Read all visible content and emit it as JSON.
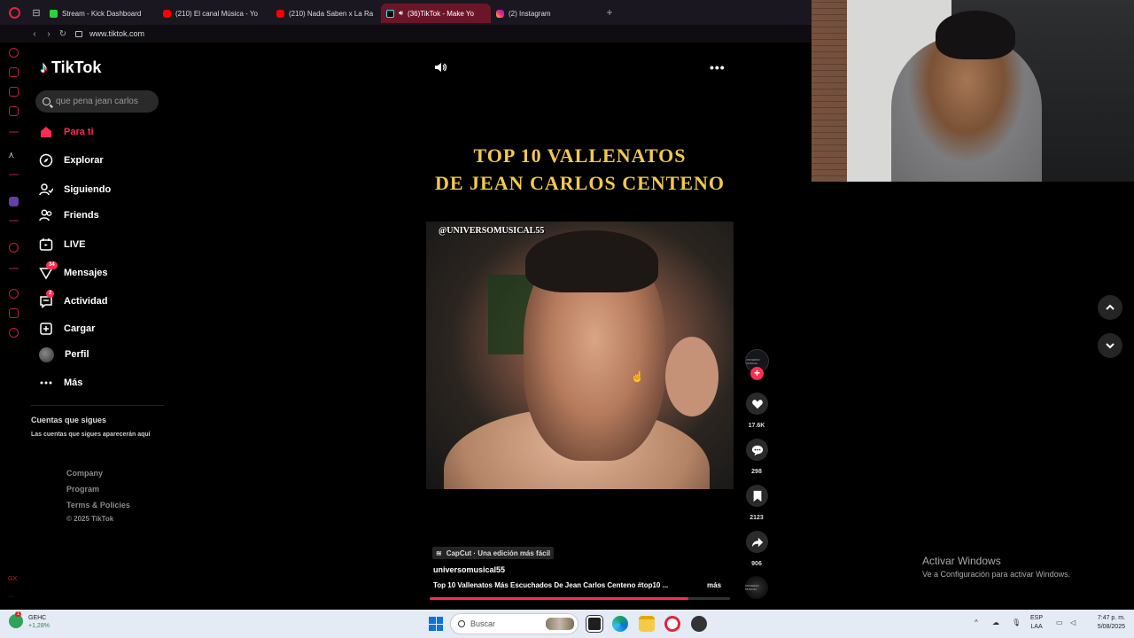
{
  "browser": {
    "tabs": [
      {
        "label": "Stream - Kick Dashboard",
        "favicon": "kick-icon",
        "active": false
      },
      {
        "label": "(210) El canal Música - Yo",
        "favicon": "youtube-icon",
        "active": false
      },
      {
        "label": "(210) Nada Saben x La Ra",
        "favicon": "youtube-icon",
        "active": false
      },
      {
        "label": "(36)TikTok - Make Yo",
        "favicon": "tiktok-icon",
        "active": true
      },
      {
        "label": "(2) Instagram",
        "favicon": "instagram-icon",
        "active": false
      }
    ],
    "new_tab_label": "+",
    "url": "www.tiktok.com",
    "accent": "#e0253a"
  },
  "tiktok": {
    "logo_text": "TikTok",
    "search_placeholder": "que pena jean carlos",
    "nav": [
      {
        "label": "Para ti",
        "icon": "home-icon",
        "active": true
      },
      {
        "label": "Explorar",
        "icon": "compass-icon"
      },
      {
        "label": "Siguiendo",
        "icon": "following-icon"
      },
      {
        "label": "Friends",
        "icon": "friends-icon"
      },
      {
        "label": "LIVE",
        "icon": "live-icon"
      },
      {
        "label": "Mensajes",
        "icon": "messages-icon",
        "badge": "34"
      },
      {
        "label": "Actividad",
        "icon": "activity-icon",
        "badge": "2"
      },
      {
        "label": "Cargar",
        "icon": "upload-icon"
      },
      {
        "label": "Perfil",
        "icon": "profile-avatar"
      },
      {
        "label": "Más",
        "icon": "more-icon"
      }
    ],
    "following_title": "Cuentas que sigues",
    "following_sub": "Las cuentas que sigues aparecerán aquí",
    "footer_links": [
      "Company",
      "Program",
      "Terms & Policies"
    ],
    "copyright": "© 2025 TikTok",
    "brand_color": "#fe2c55"
  },
  "video": {
    "title_line1": "TOP 10 VALLENATOS",
    "title_line2": "DE JEAN CARLOS CENTENO",
    "watermark": "@UNIVERSOMUSICAL55",
    "capcut_label": "CapCut · Una edición más fácil",
    "author": "universomusical55",
    "description": "Top 10 Vallenatos Más Escuchados De Jean Carlos Centeno #top10 ...",
    "more_label": "más",
    "progress": 0.86,
    "title_color": "#f2c94c"
  },
  "actions": {
    "likes": "17.6K",
    "comments": "298",
    "saves": "2123",
    "shares": "906",
    "avatar_text": "UNIVERSO MUSICAL"
  },
  "windows": {
    "activate_title": "Activar Windows",
    "activate_sub": "Ve a Configuración para activar Windows."
  },
  "taskbar": {
    "weather_badge": "1",
    "weather_label": "GEHC",
    "weather_change": "+1,28%",
    "search_placeholder": "Buscar",
    "lang_top": "ESP",
    "lang_bottom": "LAA",
    "time": "7:47 p. m.",
    "date": "5/08/2025"
  }
}
